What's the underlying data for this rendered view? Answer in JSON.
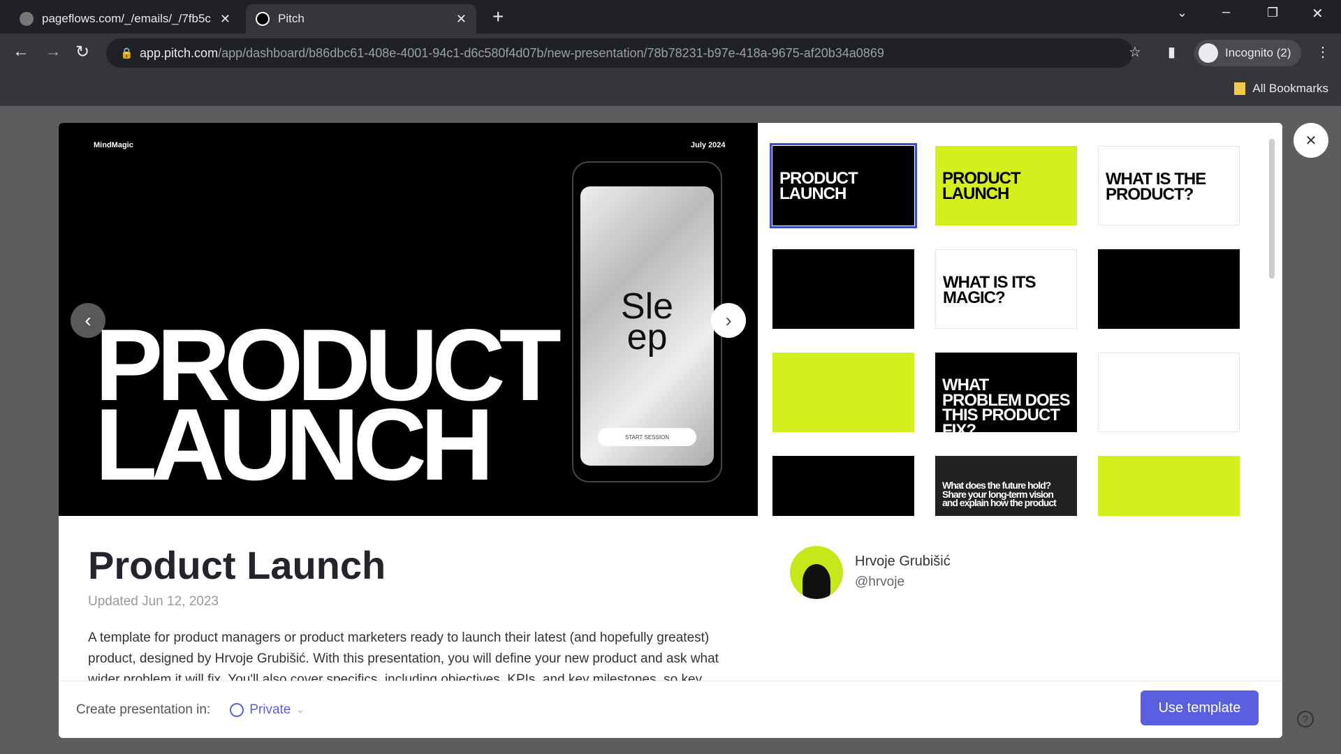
{
  "browser": {
    "tabs": [
      {
        "title": "pageflows.com/_/emails/_/7fb5c"
      },
      {
        "title": "Pitch"
      }
    ],
    "url_host": "app.pitch.com",
    "url_path": "/app/dashboard/b86dbc61-408e-4001-94c1-d6c580f4d07b/new-presentation/78b78231-b97e-418a-9675-af20b34a0869",
    "profile": "Incognito (2)",
    "bookmarks": "All Bookmarks"
  },
  "preview": {
    "brand": "MindMagic",
    "date": "July 2024",
    "title_line1": "PRODUCT",
    "title_line2": "LAUNCH",
    "phone_text1": "Sle",
    "phone_text2": "ep",
    "phone_button": "START SESSION"
  },
  "thumbnails": [
    {
      "text": "PRODUCT LAUNCH",
      "bg": "#000",
      "fg": "#fff"
    },
    {
      "text": "PRODUCT LAUNCH",
      "bg": "#d4f01c",
      "fg": "#000"
    },
    {
      "text": "WHAT IS THE PRODUCT?",
      "bg": "#fff",
      "fg": "#000"
    },
    {
      "text": "",
      "bg": "#000",
      "fg": "#fff"
    },
    {
      "text": "WHAT IS ITS MAGIC?",
      "bg": "#fff",
      "fg": "#000"
    },
    {
      "text": "",
      "bg": "#000",
      "fg": "#fff"
    },
    {
      "text": "",
      "bg": "#d4f01c",
      "fg": "#000"
    },
    {
      "text": "WHAT PROBLEM DOES THIS PRODUCT FIX?",
      "bg": "#000",
      "fg": "#fff"
    },
    {
      "text": "",
      "bg": "#fff",
      "fg": "#000"
    },
    {
      "text": "",
      "bg": "#000",
      "fg": "#fff"
    },
    {
      "text": "What does the future hold? Share your long-term vision and explain how the product",
      "bg": "#222",
      "fg": "#fff"
    },
    {
      "text": "",
      "bg": "#d4f01c",
      "fg": "#000"
    }
  ],
  "template": {
    "title": "Product Launch",
    "updated": "Updated Jun 12, 2023",
    "author_name": "Hrvoje Grubišić",
    "author_handle": "@hrvoje",
    "description": "A template for product managers or product marketers ready to launch their latest (and hopefully greatest) product, designed by Hrvoje Grubišić. With this presentation, you will define your new product and ask what wider problem it will fix. You'll also cover specifics, including objectives, KPIs, and key milestones, so key"
  },
  "footer": {
    "label": "Create presentation in:",
    "workspace": "Private",
    "button": "Use template"
  },
  "colors": {
    "accent": "#5a5fe0",
    "lime": "#d4f01c"
  }
}
